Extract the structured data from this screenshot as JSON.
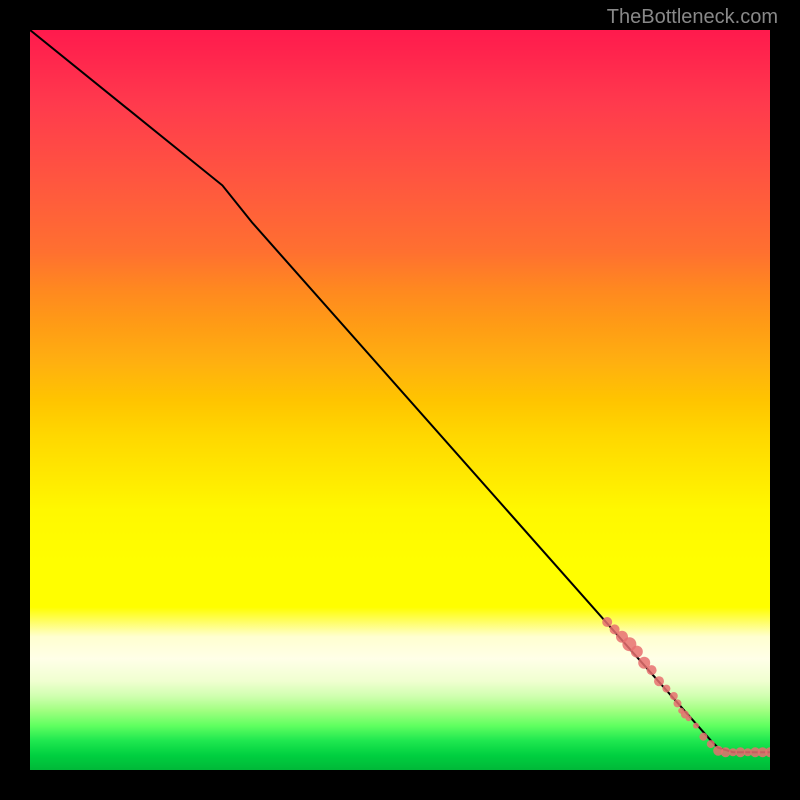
{
  "watermark": "TheBottleneck.com",
  "chart_data": {
    "type": "line",
    "title": "",
    "xlabel": "",
    "ylabel": "",
    "xlim": [
      0,
      100
    ],
    "ylim": [
      0,
      100
    ],
    "series": [
      {
        "name": "curve",
        "type": "line",
        "color": "#000000",
        "points": [
          {
            "x": 0,
            "y": 100
          },
          {
            "x": 26,
            "y": 79
          },
          {
            "x": 30,
            "y": 74
          },
          {
            "x": 92,
            "y": 4
          },
          {
            "x": 93,
            "y": 3
          },
          {
            "x": 95,
            "y": 2.4
          },
          {
            "x": 100,
            "y": 2.4
          }
        ]
      },
      {
        "name": "scatter-cluster",
        "type": "scatter",
        "color": "#e87070",
        "points": [
          {
            "x": 78,
            "y": 20,
            "r": 5
          },
          {
            "x": 79,
            "y": 19,
            "r": 5
          },
          {
            "x": 80,
            "y": 18,
            "r": 6
          },
          {
            "x": 81,
            "y": 17,
            "r": 7
          },
          {
            "x": 82,
            "y": 16,
            "r": 6
          },
          {
            "x": 83,
            "y": 14.5,
            "r": 6
          },
          {
            "x": 84,
            "y": 13.5,
            "r": 5
          },
          {
            "x": 85,
            "y": 12,
            "r": 5
          },
          {
            "x": 86,
            "y": 11,
            "r": 4
          },
          {
            "x": 87,
            "y": 10,
            "r": 4
          },
          {
            "x": 87.5,
            "y": 9,
            "r": 4
          },
          {
            "x": 88,
            "y": 8,
            "r": 3
          },
          {
            "x": 88.5,
            "y": 7.5,
            "r": 4
          },
          {
            "x": 89,
            "y": 7,
            "r": 3
          },
          {
            "x": 90,
            "y": 6,
            "r": 3
          },
          {
            "x": 91,
            "y": 4.5,
            "r": 4
          },
          {
            "x": 92,
            "y": 3.5,
            "r": 4
          },
          {
            "x": 93,
            "y": 2.6,
            "r": 5
          },
          {
            "x": 94,
            "y": 2.4,
            "r": 5
          },
          {
            "x": 95,
            "y": 2.4,
            "r": 4
          },
          {
            "x": 96,
            "y": 2.4,
            "r": 5
          },
          {
            "x": 97,
            "y": 2.4,
            "r": 4
          },
          {
            "x": 98,
            "y": 2.4,
            "r": 5
          },
          {
            "x": 99,
            "y": 2.4,
            "r": 5
          },
          {
            "x": 100,
            "y": 2.4,
            "r": 5
          },
          {
            "x": 101,
            "y": 2.4,
            "r": 4
          },
          {
            "x": 103,
            "y": 2.4,
            "r": 5
          }
        ]
      }
    ],
    "gradient_stops": [
      {
        "pos": 0,
        "color": "#ff1a4d"
      },
      {
        "pos": 50,
        "color": "#ffd800"
      },
      {
        "pos": 72,
        "color": "#fffe00"
      },
      {
        "pos": 85,
        "color": "#ffffe8"
      },
      {
        "pos": 92,
        "color": "#a0ff80"
      },
      {
        "pos": 100,
        "color": "#00b838"
      }
    ]
  }
}
